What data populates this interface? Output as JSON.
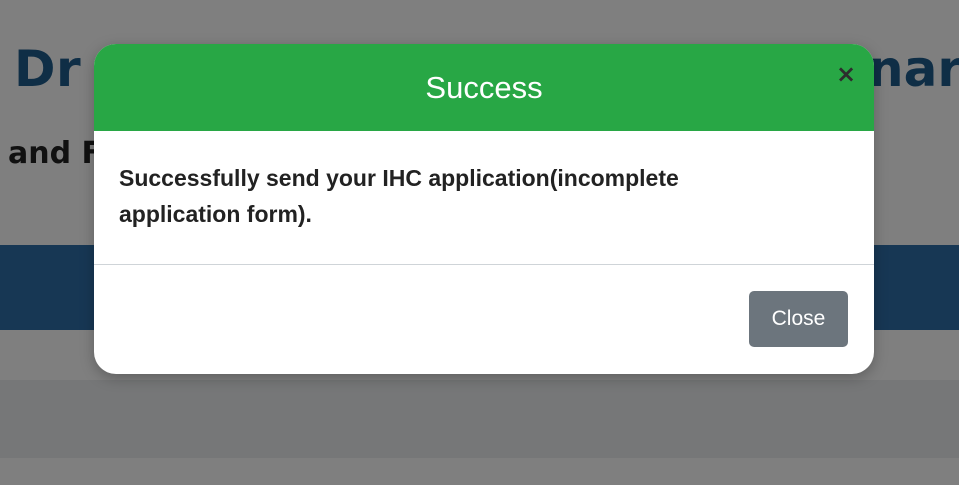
{
  "background": {
    "title_left": "Dr",
    "title_right": "nar",
    "subtitle": "and F"
  },
  "modal": {
    "title": "Success",
    "close_icon": "×",
    "message": "Successfully send your IHC application(incomplete application form).",
    "close_button_label": "Close"
  },
  "colors": {
    "header_green": "#28a745",
    "close_button_gray": "#6c757d",
    "navbar_blue": "#2f6fa8",
    "title_blue": "#1f5c8c"
  }
}
